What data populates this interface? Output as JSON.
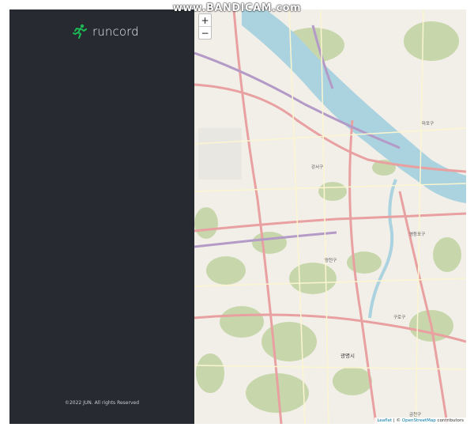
{
  "app": {
    "brand_name": "runcord",
    "brand_icon": "runner-icon",
    "footer": "©2022 JUN. All rights Reserved"
  },
  "map": {
    "zoom_in": "+",
    "zoom_out": "−",
    "attribution": {
      "leaflet": "Leaflet",
      "separator": " | © ",
      "osm": "OpenStreetMap",
      "suffix": " contributors"
    },
    "labels": {
      "district_gangseo": "강서구",
      "district_yangcheon": "양천구",
      "district_guro": "구로구",
      "district_yeongdeungpo": "영등포구",
      "district_mapo": "마포구",
      "city_gwangmyeong": "광명시",
      "district_geumcheon": "금천구"
    }
  },
  "overlay": {
    "watermark": "www.BANDICAM.com"
  },
  "colors": {
    "sidebar_bg": "#272b31",
    "brand_accent": "#1db954",
    "river": "#aad3df",
    "park": "#c8d7ab",
    "road_major": "#e8a0a0",
    "road_minor": "#f7f2c9"
  }
}
